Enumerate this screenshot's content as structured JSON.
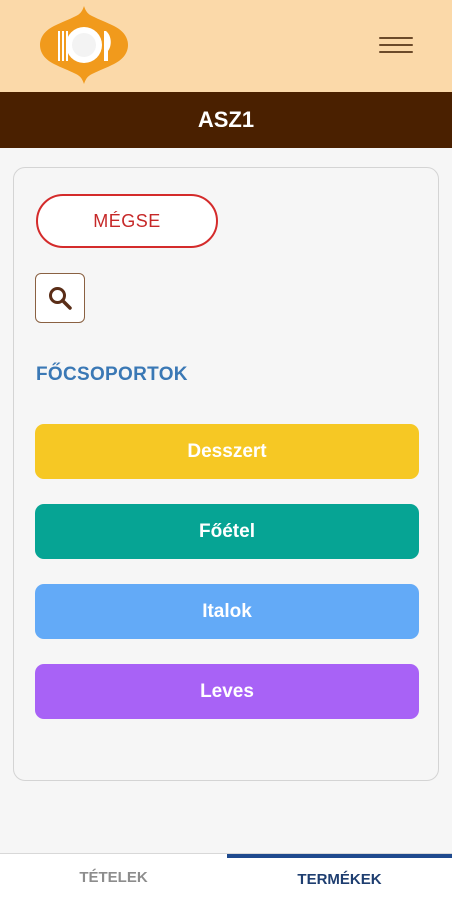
{
  "header": {
    "title": "ASZ1"
  },
  "actions": {
    "cancel_label": "MÉGSE"
  },
  "search": {
    "icon": "search-icon"
  },
  "section": {
    "title": "FŐCSOPORTOK"
  },
  "categories": [
    {
      "label": "Desszert",
      "color": "#f6c824"
    },
    {
      "label": "Főétel",
      "color": "#06a494"
    },
    {
      "label": "Italok",
      "color": "#63aaf7"
    },
    {
      "label": "Leves",
      "color": "#a862f6"
    }
  ],
  "tabs": [
    {
      "label": "TÉTELEK",
      "active": false
    },
    {
      "label": "TERMÉKEK",
      "active": true
    }
  ]
}
